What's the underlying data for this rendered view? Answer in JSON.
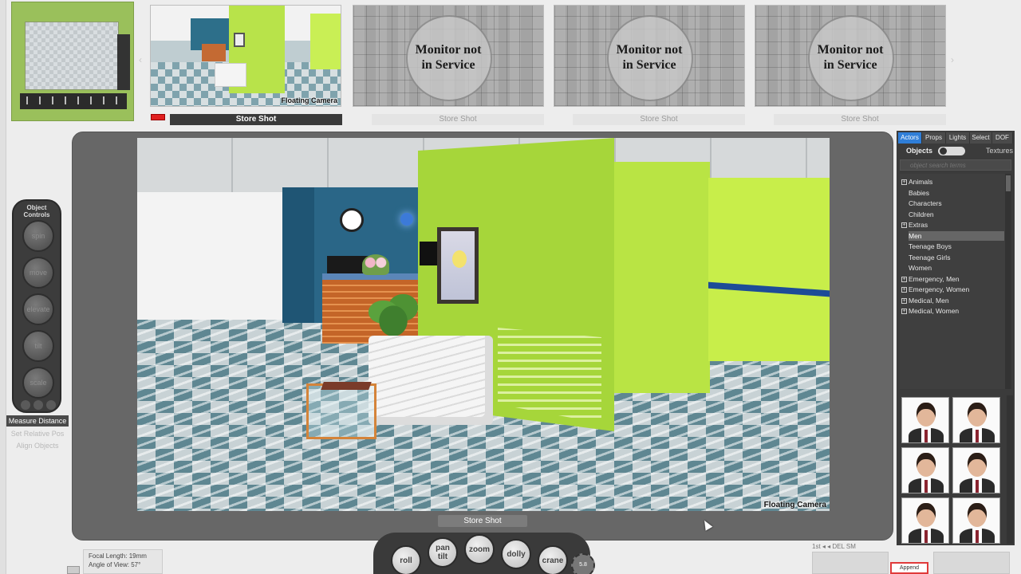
{
  "shots_bar": {
    "active_shot_caption": "Floating Camera",
    "slots": [
      {
        "label": "Store Shot",
        "state": "active"
      },
      {
        "label": "Store Shot",
        "state": "off",
        "message": "Monitor not in Service",
        "message_line1": "Monitor not",
        "message_line2": "in Service"
      },
      {
        "label": "Store Shot",
        "state": "off",
        "message": "Monitor not in Service",
        "message_line1": "Monitor not",
        "message_line2": "in Service"
      },
      {
        "label": "Store Shot",
        "state": "off",
        "message": "Monitor not in Service",
        "message_line1": "Monitor not",
        "message_line2": "in Service"
      }
    ],
    "prev_arrow": "‹",
    "next_arrow": "›"
  },
  "viewport": {
    "caption": "Floating Camera",
    "store_shot_label": "Store Shot"
  },
  "object_controls": {
    "title_line1": "Object",
    "title_line2": "Controls",
    "buttons": [
      "spin",
      "move",
      "elevate",
      "tilt",
      "scale"
    ]
  },
  "side_menu": {
    "measure_distance": "Measure Distance",
    "set_relative_pos": "Set Relative Pos",
    "align_objects": "Align Objects"
  },
  "camera_info": {
    "focal_length": "Focal Length: 19mm",
    "angle_of_view": "Angle of View: 57°"
  },
  "camera_controls": {
    "roll": "roll",
    "pan": "pan",
    "tilt": "tilt",
    "zoom": "zoom",
    "dolly": "dolly",
    "crane": "crane",
    "gear_value": "5.8"
  },
  "right_panel": {
    "tabs": [
      "Actors",
      "Props",
      "Lights",
      "Select",
      "DOF"
    ],
    "active_tab": "Actors",
    "objects_label": "Objects",
    "textures_label": "Textures",
    "search_placeholder": "object search terms",
    "tree": [
      {
        "label": "Animals",
        "expandable": true,
        "indent": 0
      },
      {
        "label": "Babies",
        "expandable": false,
        "indent": 0
      },
      {
        "label": "Characters",
        "expandable": false,
        "indent": 0
      },
      {
        "label": "Children",
        "expandable": false,
        "indent": 0
      },
      {
        "label": "Extras",
        "expandable": true,
        "indent": 0
      },
      {
        "label": "Men",
        "expandable": false,
        "indent": 1,
        "selected": true
      },
      {
        "label": "Teenage Boys",
        "expandable": false,
        "indent": 1
      },
      {
        "label": "Teenage Girls",
        "expandable": false,
        "indent": 1
      },
      {
        "label": "Women",
        "expandable": false,
        "indent": 1
      },
      {
        "label": "Emergency, Men",
        "expandable": true,
        "indent": 0
      },
      {
        "label": "Emergency, Women",
        "expandable": true,
        "indent": 0
      },
      {
        "label": "Medical, Men",
        "expandable": true,
        "indent": 0
      },
      {
        "label": "Medical, Women",
        "expandable": true,
        "indent": 0
      }
    ],
    "thumbnail_count": 6
  },
  "bottom_right": {
    "page_nav": "1st   ◂ ◂  DEL  SM",
    "append_label": "Append"
  },
  "colors": {
    "accent_tab": "#2f7ed8",
    "rec_marker": "#e01f1f",
    "green_wall": "#a6d63a"
  }
}
